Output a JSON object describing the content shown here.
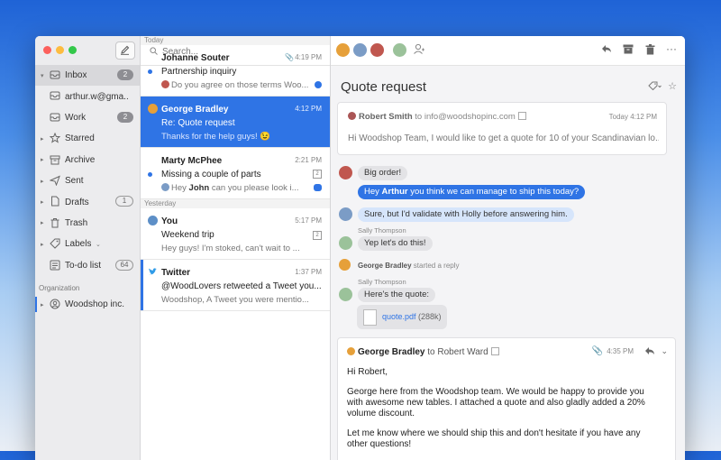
{
  "sidebar": {
    "items": [
      {
        "label": "Inbox",
        "badge": "2",
        "arrow": "▾",
        "icon": "inbox-icon"
      },
      {
        "label": "arthur.w@gma...",
        "badge": "",
        "arrow": "",
        "icon": "inbox-icon"
      },
      {
        "label": "Work",
        "badge": "2",
        "arrow": "",
        "icon": "inbox-icon"
      },
      {
        "label": "Starred",
        "badge": "",
        "arrow": "▸",
        "icon": "star-icon"
      },
      {
        "label": "Archive",
        "badge": "",
        "arrow": "▸",
        "icon": "archive-icon"
      },
      {
        "label": "Sent",
        "badge": "",
        "arrow": "▸",
        "icon": "send-icon"
      },
      {
        "label": "Drafts",
        "badge": "1",
        "arrow": "▸",
        "icon": "draft-icon"
      },
      {
        "label": "Trash",
        "badge": "",
        "arrow": "▸",
        "icon": "trash-icon"
      },
      {
        "label": "Labels",
        "badge": "",
        "arrow": "▸",
        "icon": "tag-icon"
      },
      {
        "label": "To-do list",
        "badge": "64",
        "arrow": "",
        "icon": "checklist-icon"
      }
    ],
    "org_label": "Organization",
    "org_item": "Woodshop inc."
  },
  "search": {
    "placeholder": "Search..."
  },
  "list": {
    "today": "Today",
    "yesterday": "Yesterday",
    "messages": [
      {
        "from": "Johanne Souter",
        "time": "4:19 PM",
        "subject": "Partnership inquiry",
        "preview": "Do you agree on those terms Woo..."
      },
      {
        "from": "George Bradley",
        "time": "4:12 PM",
        "subject": "Re: Quote request",
        "preview": "Thanks for the help guys! 😉"
      },
      {
        "from": "Marty McPhee",
        "time": "2:21 PM",
        "subject": "Missing a couple of parts",
        "preview_pre": "Hey ",
        "preview_bold": "John",
        "preview_post": " can you please look i..."
      },
      {
        "from": "You",
        "time": "5:17 PM",
        "subject": "Weekend trip",
        "preview": "Hey guys! I'm stoked, can't wait to ..."
      },
      {
        "from": "Twitter",
        "time": "1:37 PM",
        "subject": "@WoodLovers retweeted a Tweet you...",
        "preview": "Woodshop, A Tweet you were mentio..."
      }
    ]
  },
  "pane": {
    "title": "Quote request",
    "original": {
      "sender": "Robert Smith",
      "to": "to info@woodshopinc.com",
      "time": "Today 4:12 PM",
      "body": "Hi Woodshop Team, I would like to get a quote for 10 of your Scandinavian lo..."
    },
    "chat": {
      "c1": "Big order!",
      "c2_pre": "Hey ",
      "c2_bold": "Arthur",
      "c2_post": " you think we can manage to ship this today?",
      "c3": "Sure, but I'd validate with Holly before answering him.",
      "sally1": "Sally Thompson",
      "c4": "Yep let's do this!",
      "reply_name": "George Bradley",
      "reply_text": " started a reply",
      "sally2": "Sally Thompson",
      "c5": "Here's the quote:",
      "file_name": "quote.pdf",
      "file_size": " (288k)"
    },
    "reply": {
      "sender": "George Bradley",
      "to": " to Robert Ward",
      "time": "4:35 PM",
      "greeting": "Hi Robert,",
      "p1": "George here from the Woodshop team. We would be happy to provide you with awesome new tables. I attached a quote and also gladly added a 20% volume discount.",
      "p2": "Let me know where we should ship this and don't hesitate if you have any other questions!"
    }
  },
  "colors": {
    "accent": "#2f74e5",
    "close": "#fc605c",
    "minimize": "#fdbc40",
    "zoom": "#34c84a"
  }
}
